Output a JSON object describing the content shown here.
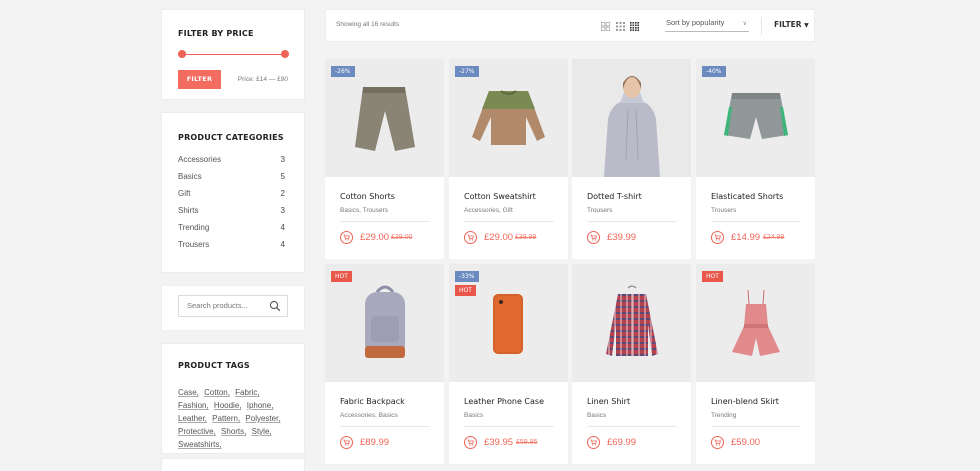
{
  "price_filter": {
    "title": "FILTER BY PRICE",
    "button_label": "FILTER",
    "price_range_label": "Price: £14 — £90"
  },
  "categories": {
    "title": "PRODUCT CATEGORIES",
    "items": [
      {
        "label": "Accessories",
        "count": "3"
      },
      {
        "label": "Basics",
        "count": "5"
      },
      {
        "label": "Gift",
        "count": "2"
      },
      {
        "label": "Shirts",
        "count": "3"
      },
      {
        "label": "Trending",
        "count": "4"
      },
      {
        "label": "Trousers",
        "count": "4"
      }
    ]
  },
  "search": {
    "placeholder": "Search products...",
    "icon": "search-icon"
  },
  "tags": {
    "title": "PRODUCT TAGS",
    "items": [
      "Case,",
      "Cotton,",
      "Fabric,",
      "Fashion,",
      "Hoodie,",
      "Iphone,",
      "Leather,",
      "Pattern,",
      "Polyester,",
      "Protective,",
      "Shorts,",
      "Style,",
      "Sweatshirts,"
    ]
  },
  "toolbar": {
    "result_count": "Showing all 16 results",
    "view_icons": [
      "grid-2-icon",
      "grid-3-icon",
      "grid-4-icon"
    ],
    "sort_value": "Sort by popularity",
    "filter_label": "FILTER"
  },
  "products": [
    {
      "name": "Cotton Shorts",
      "categories": "Basics, Trousers",
      "price": "£29.00",
      "old_price": "£39.00",
      "badge": "-26%"
    },
    {
      "name": "Cotton Sweatshirt",
      "categories": "Accessories, Gift",
      "price": "£29.00",
      "old_price": "£39.99",
      "badge": "-27%"
    },
    {
      "name": "Dotted T-shirt",
      "categories": "Trousers",
      "price": "£39.99"
    },
    {
      "name": "Elasticated Shorts",
      "categories": "Trousers",
      "price": "£14.99",
      "old_price": "£24.99",
      "badge": "-40%"
    },
    {
      "name": "Fabric Backpack",
      "categories": "Accessories, Basics",
      "price": "£89.99",
      "badge2": "HOT"
    },
    {
      "name": "Leather Phone Case",
      "categories": "Basics",
      "price": "£39.95",
      "old_price": "£59.95",
      "badge": "-33%",
      "badge2": "HOT"
    },
    {
      "name": "Linen Shirt",
      "categories": "Basics",
      "price": "£69.99"
    },
    {
      "name": "Linen-blend Skirt",
      "categories": "Trending",
      "price": "£59.00",
      "badge2": "HOT"
    }
  ],
  "colors": {
    "accent": "#ef6456",
    "sale_badge": "#6b8bc0",
    "hot_badge": "#e8574a"
  }
}
